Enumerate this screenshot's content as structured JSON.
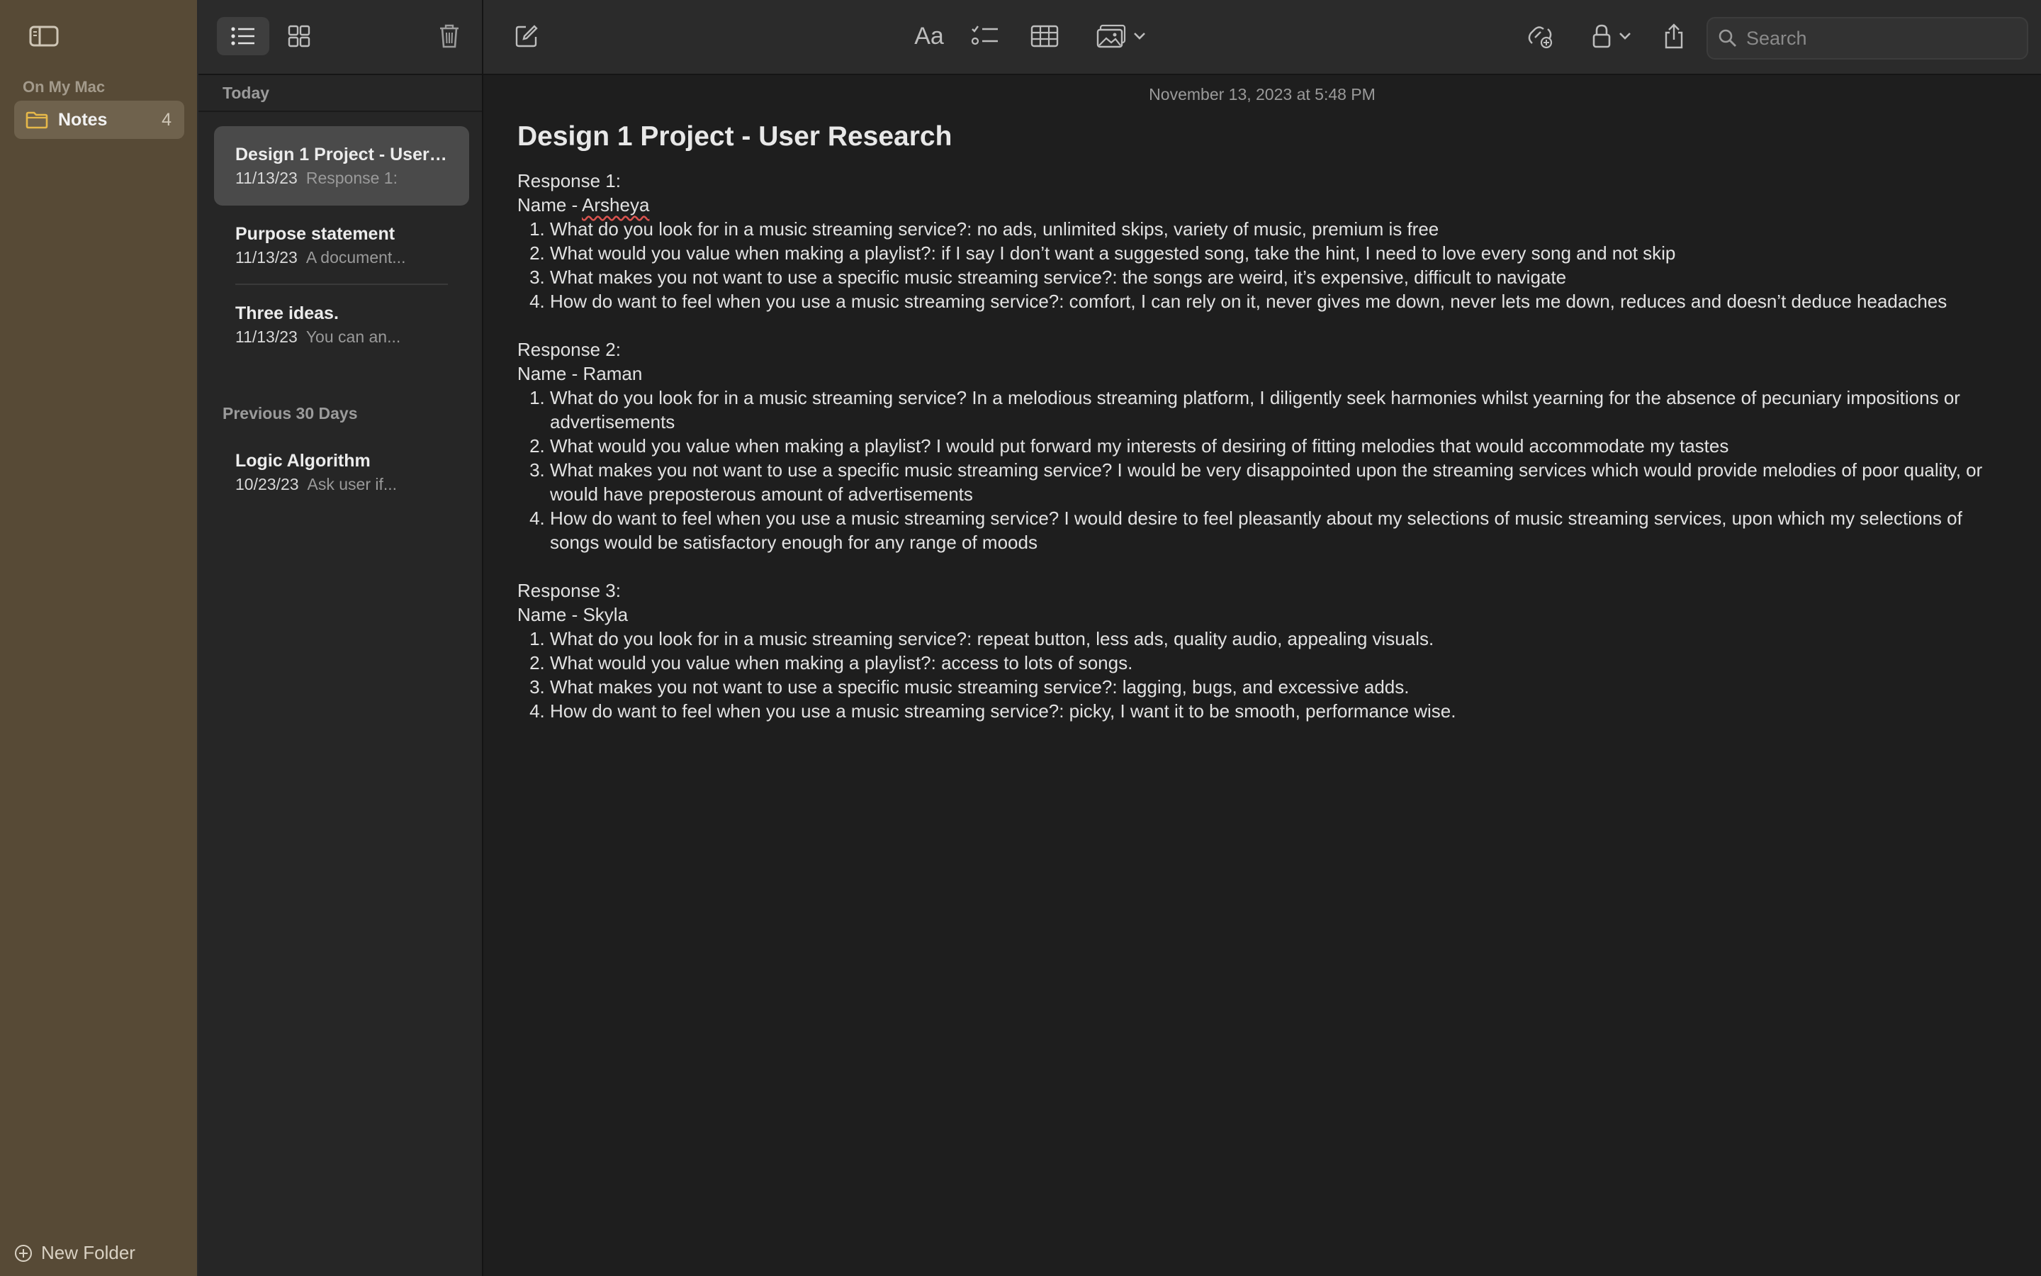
{
  "sidebar": {
    "section_label": "On My Mac",
    "folder": {
      "label": "Notes",
      "count": "4"
    },
    "new_folder_label": "New Folder",
    "accent_color": "#e6b84a"
  },
  "note_list": {
    "groups": [
      {
        "header": "Today",
        "notes": [
          {
            "title": "Design 1 Project - User Research",
            "date": "11/13/23",
            "preview": "Response 1:",
            "selected": true
          },
          {
            "title": "Purpose statement",
            "date": "11/13/23",
            "preview": "A document...",
            "selected": false
          },
          {
            "title": "Three ideas.",
            "date": "11/13/23",
            "preview": "You can an...",
            "selected": false
          }
        ]
      },
      {
        "header": "Previous 30 Days",
        "notes": [
          {
            "title": "Logic Algorithm",
            "date": "10/23/23",
            "preview": "Ask user if...",
            "selected": false
          }
        ]
      }
    ]
  },
  "toolbar": {
    "format_label": "Aa",
    "search_placeholder": "Search"
  },
  "note": {
    "timestamp": "November 13, 2023 at 5:48 PM",
    "title": "Design 1 Project - User Research",
    "responses": [
      {
        "heading": "Response 1:",
        "name_prefix": "Name - ",
        "name": "Arsheya",
        "answers": [
          "What do you look for in a music streaming service?: no ads, unlimited skips, variety of music, premium is free",
          "What would you value when making a playlist?: if I say I don’t want a suggested song, take the hint, I need to love every song and not skip",
          "What makes you not want to use a specific music streaming service?: the songs are weird, it’s expensive, difficult to navigate",
          "How do want to feel when you use a music streaming service?: comfort, I can rely on it, never gives me down, never lets me down, reduces and doesn’t deduce headaches"
        ]
      },
      {
        "heading": "Response 2:",
        "name_prefix": "Name - ",
        "name": "Raman",
        "answers": [
          "What do you look for in a music streaming service? In a melodious streaming platform, I diligently seek harmonies whilst yearning for the absence of pecuniary impositions or advertisements",
          "What would you value when making a playlist? I would put forward my interests of desiring of fitting melodies that would accommodate my tastes",
          "What makes you not want to use a specific music streaming service? I would be very disappointed upon the streaming services which would provide melodies of poor quality, or would have preposterous amount of advertisements",
          "How do want to feel when you use a music streaming service? I would desire to feel pleasantly about my selections of music streaming services, upon which my selections of songs would be satisfactory enough for any range of moods"
        ]
      },
      {
        "heading": "Response 3:",
        "name_prefix": "Name - ",
        "name": "Skyla",
        "answers": [
          "What do you look for in a music streaming service?: repeat button, less ads, quality audio, appealing visuals.",
          "What would you value when making a playlist?: access to lots of songs.",
          "What makes you not want to use a specific music streaming service?: lagging, bugs, and excessive adds.",
          "How do want to feel when you use a music streaming service?: picky, I want it to be smooth, performance wise."
        ]
      }
    ]
  }
}
